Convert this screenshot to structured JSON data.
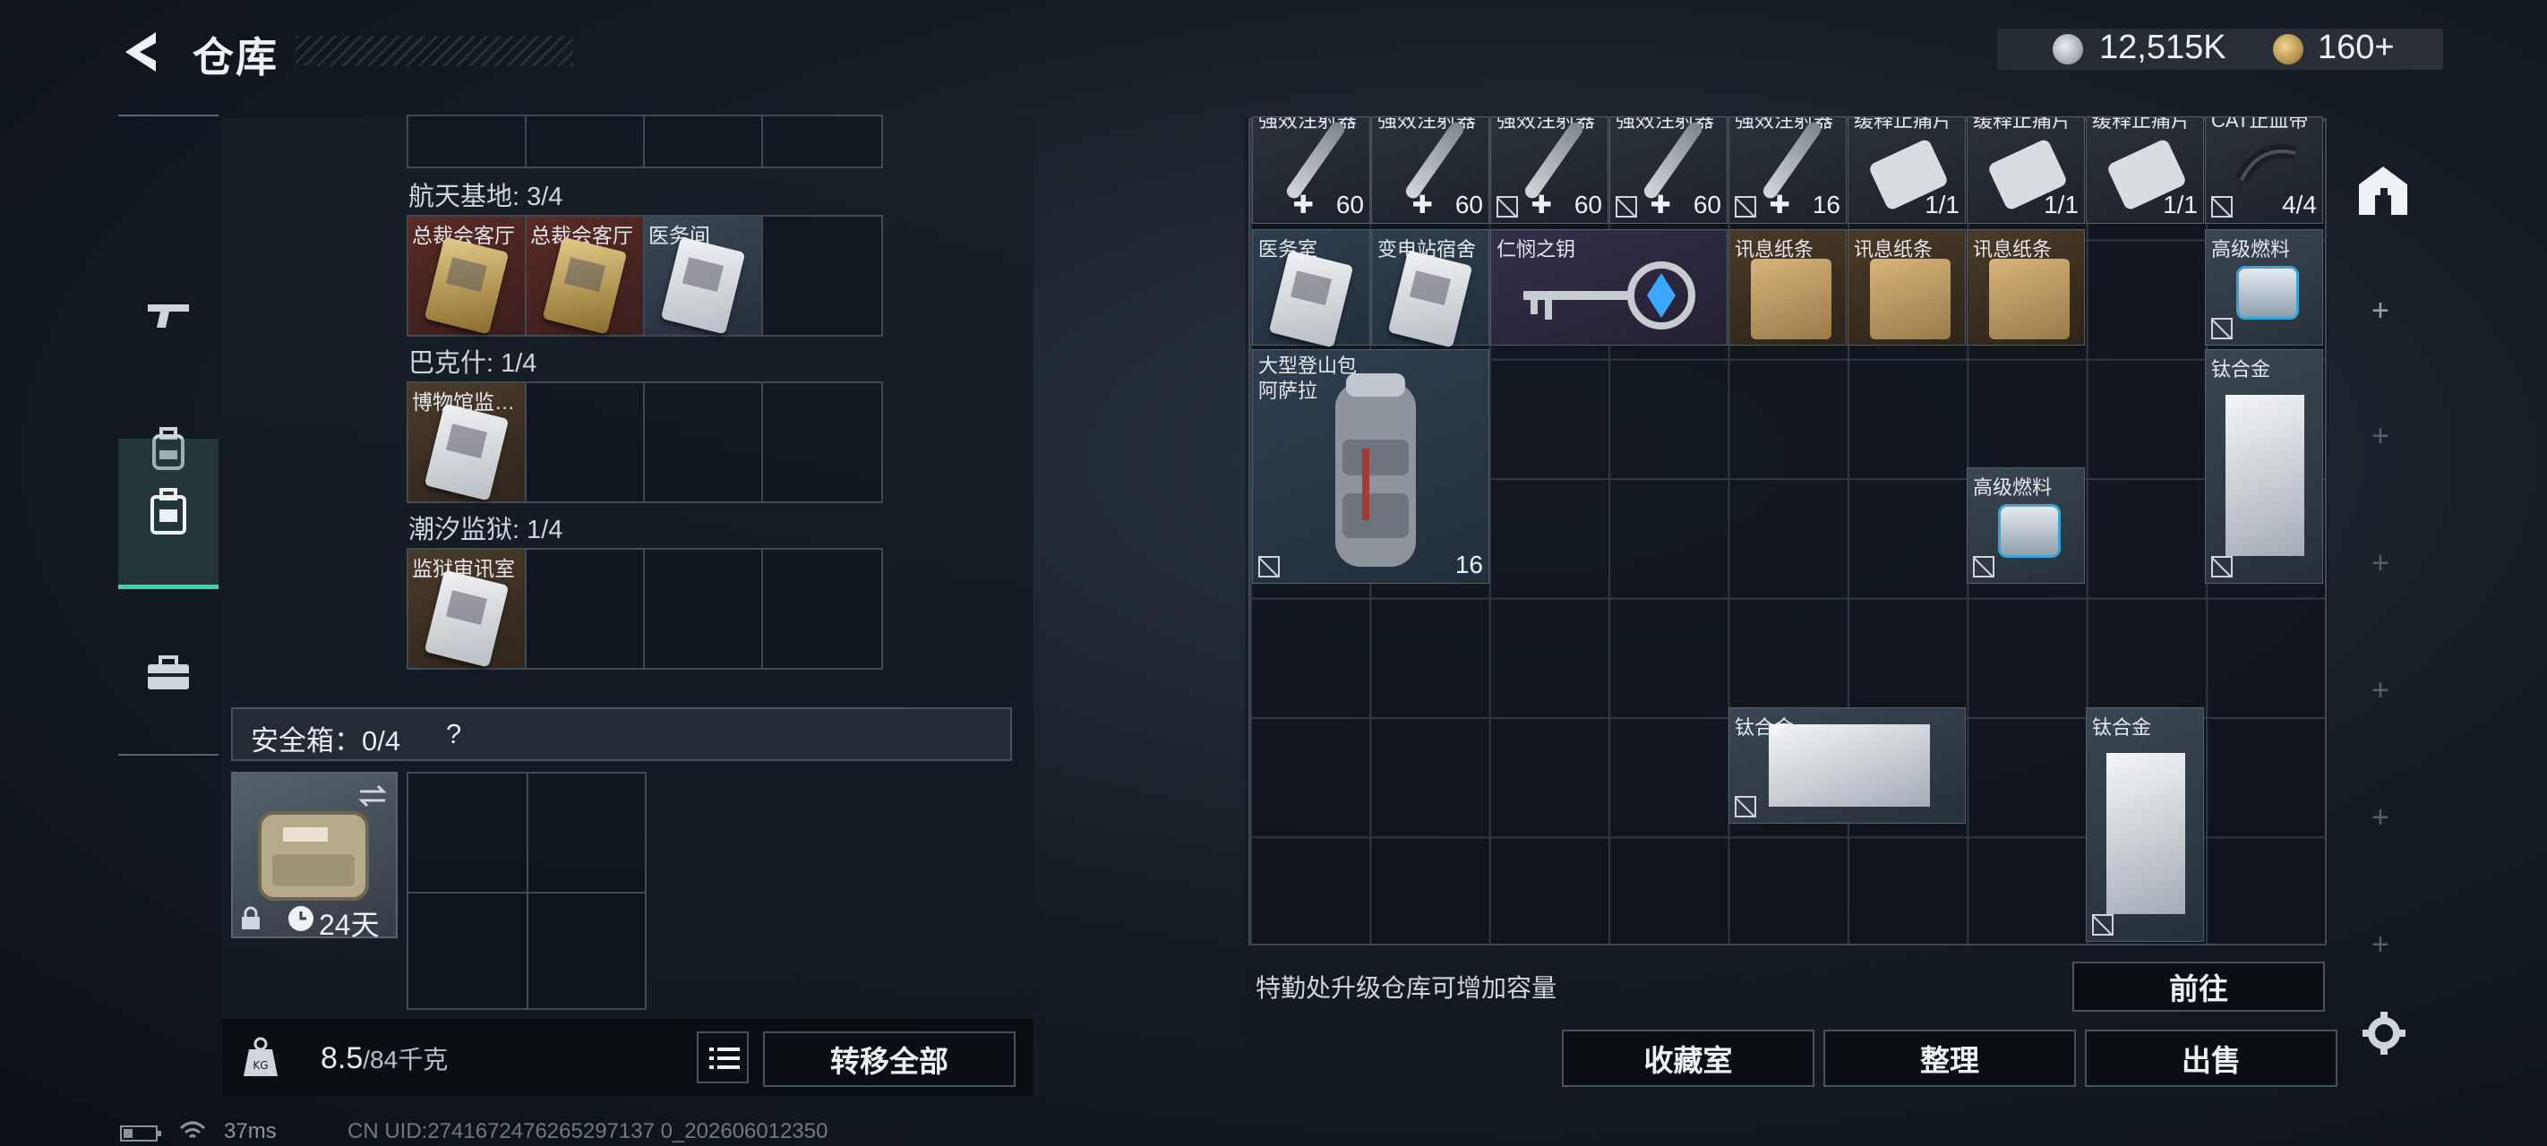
{
  "header": {
    "title": "仓库",
    "silver": "12,515K",
    "gold": "160+"
  },
  "left": {
    "sections": [
      {
        "name": "航天基地: 3/4",
        "slots": [
          {
            "label": "总裁会客厅",
            "tone": "red"
          },
          {
            "label": "总裁会客厅",
            "tone": "red"
          },
          {
            "label": "医务间",
            "tone": "blue"
          },
          {
            "label": "",
            "tone": ""
          }
        ]
      },
      {
        "name": "巴克什: 1/4",
        "slots": [
          {
            "label": "博物馆监…",
            "tone": "brown"
          },
          {
            "label": "",
            "tone": ""
          },
          {
            "label": "",
            "tone": ""
          },
          {
            "label": "",
            "tone": ""
          }
        ]
      },
      {
        "name": "潮汐监狱: 1/4",
        "slots": [
          {
            "label": "监狱审讯室",
            "tone": "brown"
          },
          {
            "label": "",
            "tone": ""
          },
          {
            "label": "",
            "tone": ""
          },
          {
            "label": "",
            "tone": ""
          }
        ]
      }
    ],
    "safe_box": {
      "label": "安全箱：0/4",
      "help": "?",
      "timer": "24天"
    },
    "weight": {
      "current": "8.5",
      "max": "/84千克"
    },
    "transfer_all": "转移全部"
  },
  "storage": {
    "row1": [
      {
        "label": "强效注射器",
        "count": "60"
      },
      {
        "label": "强效注射器",
        "count": "60"
      },
      {
        "label": "强效注射器",
        "count": "60"
      },
      {
        "label": "强效注射器",
        "count": "60"
      },
      {
        "label": "强效注射器",
        "count": "16"
      },
      {
        "label": "缓释止痛片",
        "count": "1/1"
      },
      {
        "label": "缓释止痛片",
        "count": "1/1"
      },
      {
        "label": "缓释止痛片",
        "count": "1/1"
      },
      {
        "label": "CAT止血带",
        "count": "4/4"
      }
    ],
    "row2": [
      {
        "label": "医务室"
      },
      {
        "label": "变电站宿舍"
      },
      {
        "label": "仁悯之钥"
      },
      {
        "label": "讯息纸条"
      },
      {
        "label": "讯息纸条"
      },
      {
        "label": "讯息纸条"
      },
      {
        "label": "高级燃料"
      }
    ],
    "backpack": {
      "label": "大型登山包\n阿萨拉",
      "count": "16"
    },
    "titanium_1": {
      "label": "钛合金"
    },
    "fuel_2": {
      "label": "高级燃料"
    },
    "titanium_2": {
      "label": "钛合金"
    },
    "titanium_3": {
      "label": "钛合金"
    },
    "upgrade_note": "特勤处升级仓库可增加容量",
    "goto": "前往",
    "buttons": {
      "collection": "收藏室",
      "organize": "整理",
      "sell": "出售"
    }
  },
  "status": {
    "ping": "37ms",
    "uid": "CN UID:2741672476265297137 0_202606012350"
  },
  "colors": {
    "accent": "#3bd6a8",
    "panel": "#171f27"
  }
}
